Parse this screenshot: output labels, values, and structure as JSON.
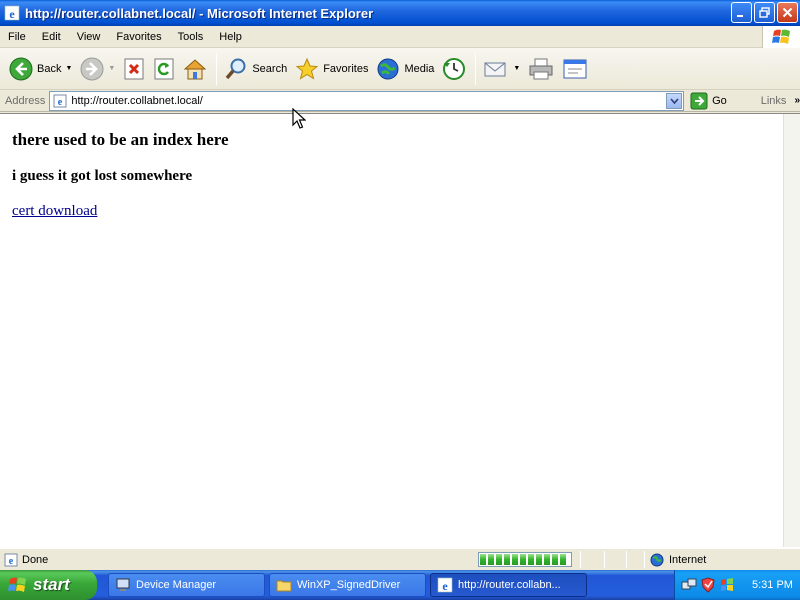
{
  "window": {
    "title": "http://router.collabnet.local/ - Microsoft Internet Explorer",
    "icons": [
      "ie-icon",
      "minimize-icon",
      "maximize-icon",
      "close-icon"
    ]
  },
  "menu": {
    "items": [
      "File",
      "Edit",
      "View",
      "Favorites",
      "Tools",
      "Help"
    ]
  },
  "toolbar": {
    "back_label": "Back",
    "search_label": "Search",
    "favorites_label": "Favorites",
    "media_label": "Media"
  },
  "address": {
    "label": "Address",
    "url": "http://router.collabnet.local/",
    "go_label": "Go",
    "links_label": "Links"
  },
  "page": {
    "heading": "there used to be an index here",
    "subheading": "i guess it got lost somewhere",
    "link_text": "cert download"
  },
  "status": {
    "text": "Done",
    "zone": "Internet",
    "progress": 1.0
  },
  "taskbar": {
    "start_label": "start",
    "tasks": [
      {
        "label": "Device Manager",
        "icon": "computer-icon"
      },
      {
        "label": "WinXP_SignedDriver",
        "icon": "folder-icon"
      },
      {
        "label": "http://router.collabn...",
        "icon": "ie-icon"
      }
    ],
    "clock": "5:31 PM"
  },
  "colors": {
    "title_bar": "#0054e3",
    "link": "#00008b",
    "taskbar": "#245edc",
    "start": "#38a838"
  }
}
